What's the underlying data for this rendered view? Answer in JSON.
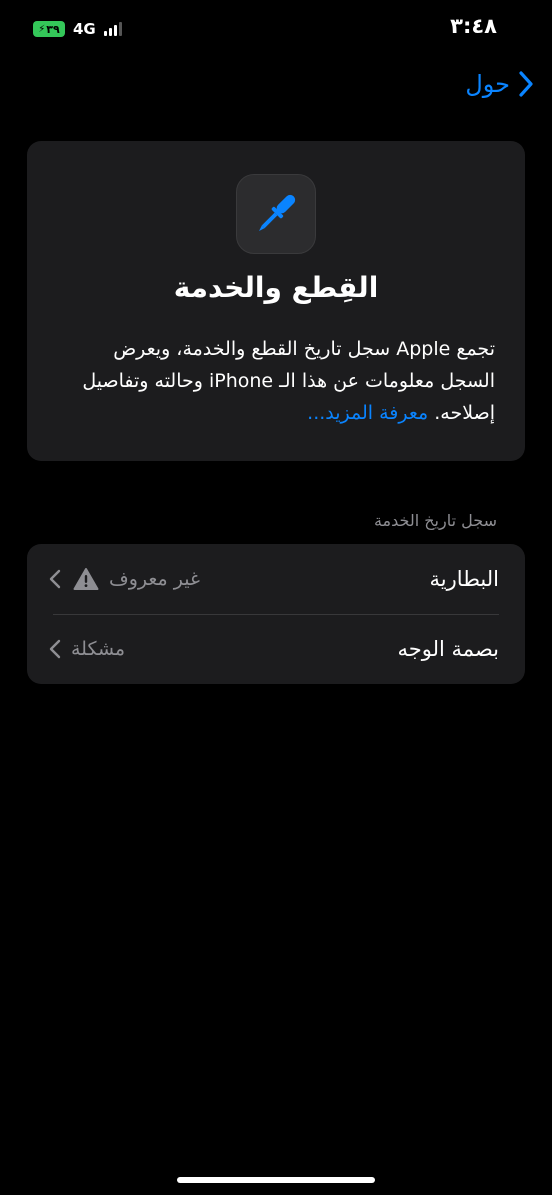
{
  "status_bar": {
    "time": "٣:٤٨",
    "battery_level": "٣٩",
    "network": "4G"
  },
  "nav": {
    "back_label": "حول"
  },
  "info_card": {
    "icon": "screwdriver-icon",
    "title": "القِطع والخدمة",
    "description": "تجمع Apple سجل تاريخ القطع والخدمة، ويعرض السجل معلومات عن هذا الـ iPhone وحالته وتفاصيل إصلاحه.",
    "learn_more": "معرفة المزيد..."
  },
  "service_history": {
    "header": "سجل تاريخ الخدمة",
    "items": [
      {
        "title": "البطارية",
        "value": "غير معروف",
        "warning": true
      },
      {
        "title": "بصمة الوجه",
        "value": "مشكلة",
        "warning": false
      }
    ]
  },
  "colors": {
    "accent": "#0a84ff",
    "card_bg": "#1c1c1e",
    "secondary_text": "#8e8e93",
    "battery": "#34c759"
  }
}
